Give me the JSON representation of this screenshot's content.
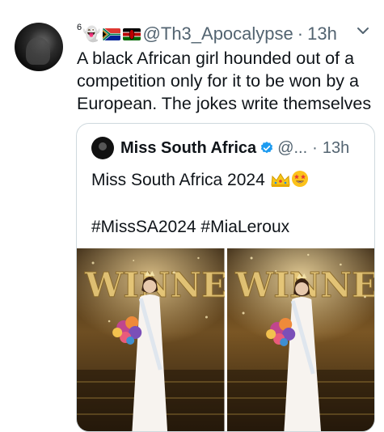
{
  "tweet": {
    "superscript": "6",
    "ghost_emoji": "👻",
    "flags": [
      "south-africa-flag",
      "kenya-flag"
    ],
    "handle": "@Th3_Apocalypse",
    "separator": "·",
    "time": "13h",
    "text_lines": [
      "A black African girl hounded out of a",
      "competition only for it to be won by a",
      "European. The jokes write themselves"
    ]
  },
  "quote": {
    "name": "Miss South Africa",
    "handle": "@...",
    "separator": "·",
    "time": "13h",
    "line1": "Miss South Africa 2024",
    "line2": "#MissSA2024 #MiaLeroux",
    "emojis": [
      "crown-icon",
      "star-struck-icon"
    ],
    "photo_banner_text": [
      "WINNE",
      "WINNE"
    ]
  },
  "colors": {
    "text": "#0f1419",
    "secondary": "#536471",
    "border": "#cfd9de",
    "verified": "#1d9bf0",
    "stage_gold": "#c9a24a"
  }
}
